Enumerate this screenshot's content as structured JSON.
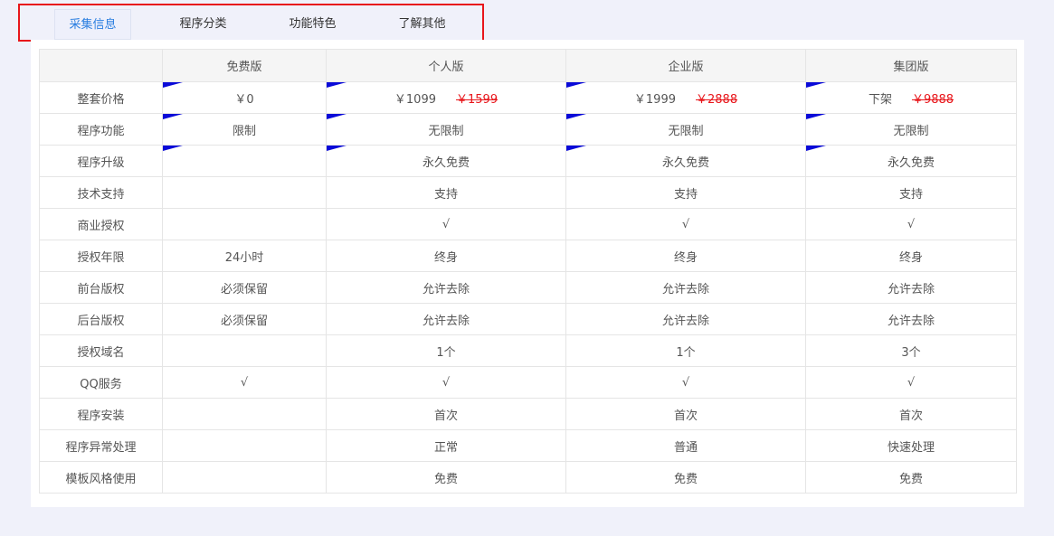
{
  "tabs": [
    {
      "label": "采集信息",
      "active": true
    },
    {
      "label": "程序分类",
      "active": false
    },
    {
      "label": "功能特色",
      "active": false
    },
    {
      "label": "了解其他",
      "active": false
    }
  ],
  "table": {
    "headers": [
      "",
      "免费版",
      "个人版",
      "企业版",
      "集团版"
    ],
    "price_row": {
      "label": "整套价格",
      "cells": [
        {
          "value": "￥0",
          "old": ""
        },
        {
          "value": "￥1099",
          "old": "￥1599"
        },
        {
          "value": "￥1999",
          "old": "￥2888"
        },
        {
          "value": "下架",
          "old": "￥9888"
        }
      ]
    },
    "rows": [
      {
        "label": "程序功能",
        "cells": [
          "限制",
          "无限制",
          "无限制",
          "无限制"
        ]
      },
      {
        "label": "程序升级",
        "cells": [
          "",
          "永久免费",
          "永久免费",
          "永久免费"
        ]
      },
      {
        "label": "技术支持",
        "cells": [
          "",
          "支持",
          "支持",
          "支持"
        ]
      },
      {
        "label": "商业授权",
        "cells": [
          "",
          "√",
          "√",
          "√"
        ]
      },
      {
        "label": "授权年限",
        "cells": [
          "24小时",
          "终身",
          "终身",
          "终身"
        ]
      },
      {
        "label": "前台版权",
        "cells": [
          "必须保留",
          "允许去除",
          "允许去除",
          "允许去除"
        ]
      },
      {
        "label": "后台版权",
        "cells": [
          "必须保留",
          "允许去除",
          "允许去除",
          "允许去除"
        ]
      },
      {
        "label": "授权域名",
        "cells": [
          "",
          "1个",
          "1个",
          "3个"
        ]
      },
      {
        "label": "QQ服务",
        "cells": [
          "√",
          "√",
          "√",
          "√"
        ]
      },
      {
        "label": "程序安装",
        "cells": [
          "",
          "首次",
          "首次",
          "首次"
        ]
      },
      {
        "label": "程序异常处理",
        "cells": [
          "",
          "正常",
          "普通",
          "快速处理"
        ]
      },
      {
        "label": "模板风格使用",
        "cells": [
          "",
          "免费",
          "免费",
          "免费"
        ]
      }
    ]
  },
  "colors": {
    "accent": "#2a7ee0",
    "highlight_border": "#e8161b",
    "strike": "#e8161b",
    "corner_flag": "#0a0ad8"
  }
}
